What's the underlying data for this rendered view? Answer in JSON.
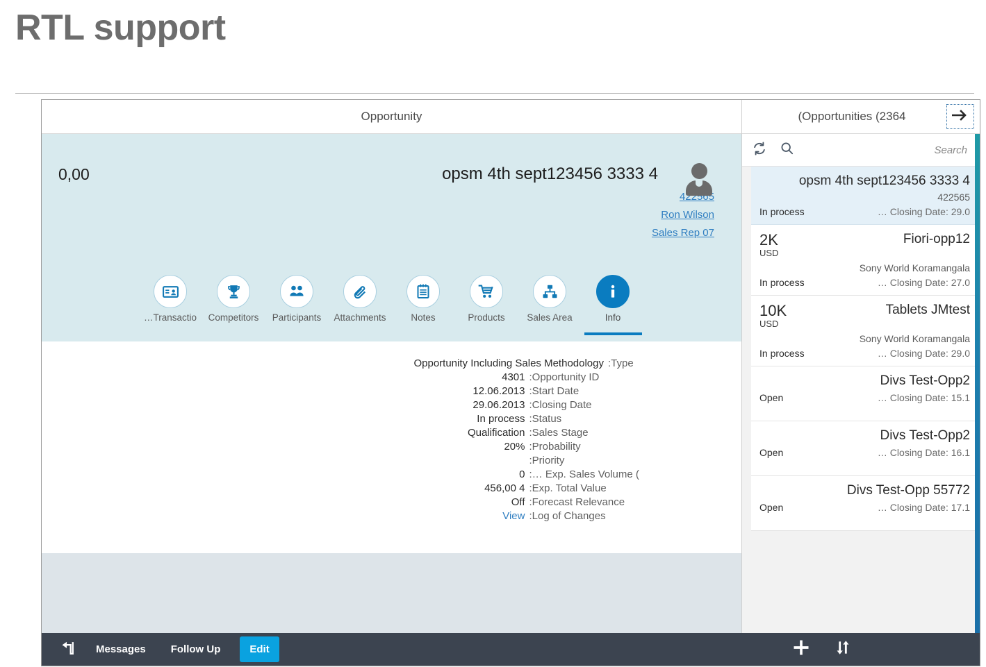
{
  "slide": {
    "title": "RTL support"
  },
  "detail": {
    "titlebar": "Opportunity",
    "amount": "0,00",
    "opportunity_name": "opsm 4th sept123456 3333 4",
    "meta": {
      "id": "422565",
      "person": "Ron Wilson",
      "role": "Sales Rep 07"
    },
    "tabs": [
      {
        "label": "…Transactio",
        "icon": "business-card-icon",
        "active": false
      },
      {
        "label": "Competitors",
        "icon": "trophy-icon",
        "active": false
      },
      {
        "label": "Participants",
        "icon": "people-icon",
        "active": false
      },
      {
        "label": "Attachments",
        "icon": "paperclip-icon",
        "active": false
      },
      {
        "label": "Notes",
        "icon": "notepad-icon",
        "active": false
      },
      {
        "label": "Products",
        "icon": "cart-icon",
        "active": false
      },
      {
        "label": "Sales Area",
        "icon": "org-chart-icon",
        "active": false
      },
      {
        "label": "Info",
        "icon": "info-icon",
        "active": true
      }
    ],
    "fields": [
      {
        "value": "Opportunity Including Sales Methodology",
        "label": ":Type",
        "link": false
      },
      {
        "value": "4301",
        "label": ":Opportunity ID",
        "link": false
      },
      {
        "value": "12.06.2013",
        "label": ":Start Date",
        "link": false
      },
      {
        "value": "29.06.2013",
        "label": ":Closing Date",
        "link": false
      },
      {
        "value": "In process",
        "label": ":Status",
        "link": false
      },
      {
        "value": "Qualification",
        "label": ":Sales Stage",
        "link": false
      },
      {
        "value": "20%",
        "label": ":Probability",
        "link": false
      },
      {
        "value": "",
        "label": ":Priority",
        "link": false
      },
      {
        "value": "0",
        "label": ":… Exp. Sales Volume (",
        "link": false
      },
      {
        "value": "456,00 4",
        "label": ":Exp. Total Value",
        "link": false
      },
      {
        "value": "Off",
        "label": ":Forecast Relevance",
        "link": false
      },
      {
        "value": "View",
        "label": ":Log of Changes",
        "link": true
      }
    ]
  },
  "list": {
    "titlebar": "(Opportunities (2364",
    "forward_icon": "arrow-right-icon",
    "refresh_icon": "refresh-icon",
    "search_icon": "search-icon",
    "search_placeholder": "Search",
    "search_value": "",
    "items": [
      {
        "amount": "",
        "currency": "",
        "title": "opsm 4th sept123456 3333 4",
        "subtitle": "422565",
        "status": "In process",
        "closing": "… Closing Date: 29.0",
        "selected": true
      },
      {
        "amount": "2K",
        "currency": "USD",
        "title": "Fiori-opp12",
        "subtitle": "Sony World Koramangala",
        "status": "In process",
        "closing": "… Closing Date: 27.0",
        "selected": false
      },
      {
        "amount": "10K",
        "currency": "USD",
        "title": "Tablets JMtest",
        "subtitle": "Sony World Koramangala",
        "status": "In process",
        "closing": "… Closing Date: 29.0",
        "selected": false
      },
      {
        "amount": "",
        "currency": "",
        "title": "Divs Test-Opp2",
        "subtitle": "",
        "status": "Open",
        "closing": "… Closing Date: 15.1",
        "selected": false
      },
      {
        "amount": "",
        "currency": "",
        "title": "Divs Test-Opp2",
        "subtitle": "",
        "status": "Open",
        "closing": "… Closing Date: 16.1",
        "selected": false
      },
      {
        "amount": "",
        "currency": "",
        "title": "Divs Test-Opp 55772",
        "subtitle": "",
        "status": "Open",
        "closing": "… Closing Date: 17.1",
        "selected": false
      }
    ]
  },
  "bottombar": {
    "back_icon": "back-arrow-icon",
    "messages_label": "Messages",
    "followup_label": "Follow Up",
    "edit_label": "Edit",
    "add_icon": "plus-icon",
    "sort_icon": "sort-icon"
  },
  "colors": {
    "accent_blue": "#0a7cc0",
    "edit_blue": "#0aa2e0",
    "header_cyan": "#d8eaee",
    "selected_row": "#e4f0f8",
    "bottom_bar": "#3c4450",
    "link_blue": "#2f7ec1"
  }
}
